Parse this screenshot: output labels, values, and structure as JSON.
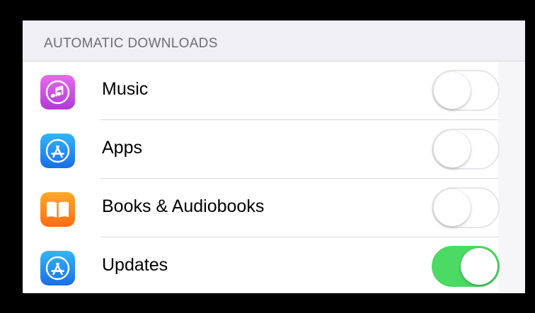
{
  "section": {
    "header": "AUTOMATIC DOWNLOADS"
  },
  "rows": [
    {
      "label": "Music",
      "icon": "itunes-music-icon",
      "icon_color": "#c644dc",
      "enabled": false
    },
    {
      "label": "Apps",
      "icon": "app-store-icon",
      "icon_color": "#1e88f0",
      "enabled": false
    },
    {
      "label": "Books & Audiobooks",
      "icon": "ibooks-icon",
      "icon_color": "#ff8a1e",
      "enabled": false
    },
    {
      "label": "Updates",
      "icon": "app-store-icon",
      "icon_color": "#1e88f0",
      "enabled": true
    }
  ],
  "colors": {
    "toggle_on": "#4cd964",
    "toggle_off_border": "#e5e5ea",
    "header_text": "#6d6d72",
    "background": "#efeff4"
  }
}
